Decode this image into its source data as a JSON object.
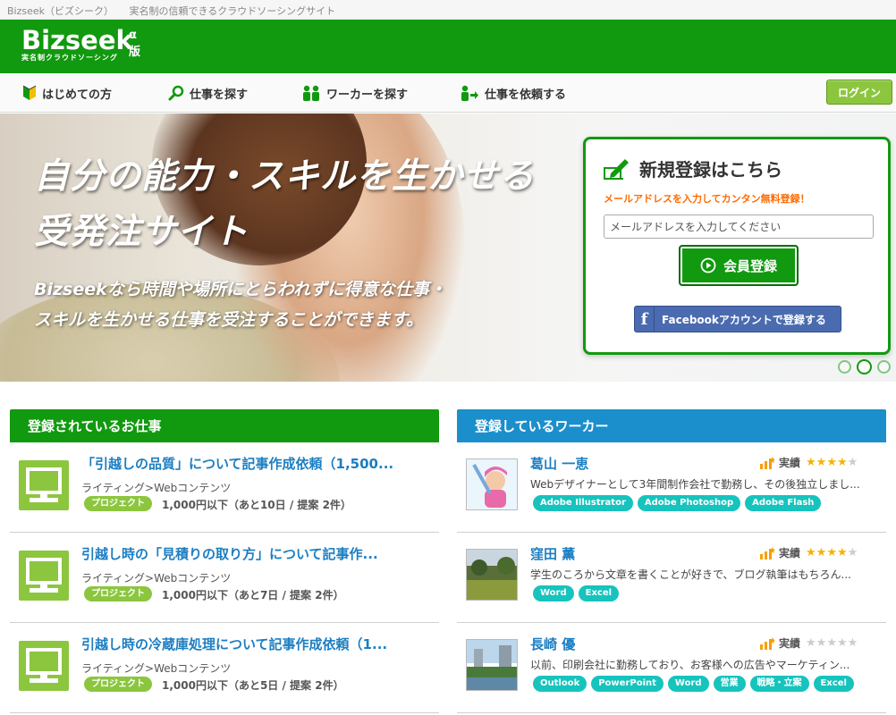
{
  "page": {
    "tab_title": "Bizseek（ビズシーク）",
    "tab_subtitle": "実名制の信頼できるクラウドソーシングサイト"
  },
  "header": {
    "logo": "Bizseek",
    "logo_version": "α版",
    "logo_tagline": "実名制クラウドソーシング",
    "brand_color": "#11990f"
  },
  "nav": {
    "items": [
      {
        "label": "はじめての方",
        "icon": "beginner-mark-icon"
      },
      {
        "label": "仕事を探す",
        "icon": "magnifier-icon"
      },
      {
        "label": "ワーカーを探す",
        "icon": "people-icon"
      },
      {
        "label": "仕事を依頼する",
        "icon": "person-arrow-icon"
      }
    ],
    "login": "ログイン"
  },
  "hero": {
    "headline_1": "自分の能力・スキルを生かせる",
    "headline_2": "受発注サイト",
    "body_1": "Bizseekなら時間や場所にとらわれずに得意な仕事・",
    "body_2": "スキルを生かせる仕事を受注することができます。",
    "slides_active": 2,
    "slides_total": 3
  },
  "register": {
    "title": "新規登録はこちら",
    "subtitle": "メールアドレスを入力してカンタン無料登録！",
    "email_placeholder": "メールアドレスを入力してください",
    "submit": "会員登録",
    "facebook": "Facebookアカウントで登録する"
  },
  "jobs": {
    "heading": "登録されているお仕事",
    "items": [
      {
        "title": "「引越しの品質」について記事作成依頼（1,500...",
        "category": "ライティング>Webコンテンツ",
        "type": "プロジェクト",
        "info": "1,000円以下（あと10日 / 提案 2件）"
      },
      {
        "title": "引越し時の「見積りの取り方」について記事作...",
        "category": "ライティング>Webコンテンツ",
        "type": "プロジェクト",
        "info": "1,000円以下（あと7日 / 提案 2件）"
      },
      {
        "title": "引越し時の冷蔵庫処理について記事作成依頼（1...",
        "category": "ライティング>Webコンテンツ",
        "type": "プロジェクト",
        "info": "1,000円以下（あと5日 / 提案 2件）"
      }
    ]
  },
  "workers": {
    "heading": "登録しているワーカー",
    "rating_label": "実績",
    "items": [
      {
        "name": "葛山 一恵",
        "desc": "Webデザイナーとして3年間制作会社で勤務し、その後独立しまし...",
        "stars": 4,
        "tags": [
          "Adobe Illustrator",
          "Adobe Photoshop",
          "Adobe Flash"
        ]
      },
      {
        "name": "窪田 薫",
        "desc": "学生のころから文章を書くことが好きで、ブログ執筆はもちろん...",
        "stars": 4,
        "tags": [
          "Word",
          "Excel"
        ]
      },
      {
        "name": "長崎 優",
        "desc": "以前、印刷会社に勤務しており、お客様への広告やマーケティン...",
        "stars": 0,
        "tags": [
          "Outlook",
          "PowerPoint",
          "Word",
          "営業",
          "戦略・立案",
          "Excel"
        ]
      }
    ]
  }
}
